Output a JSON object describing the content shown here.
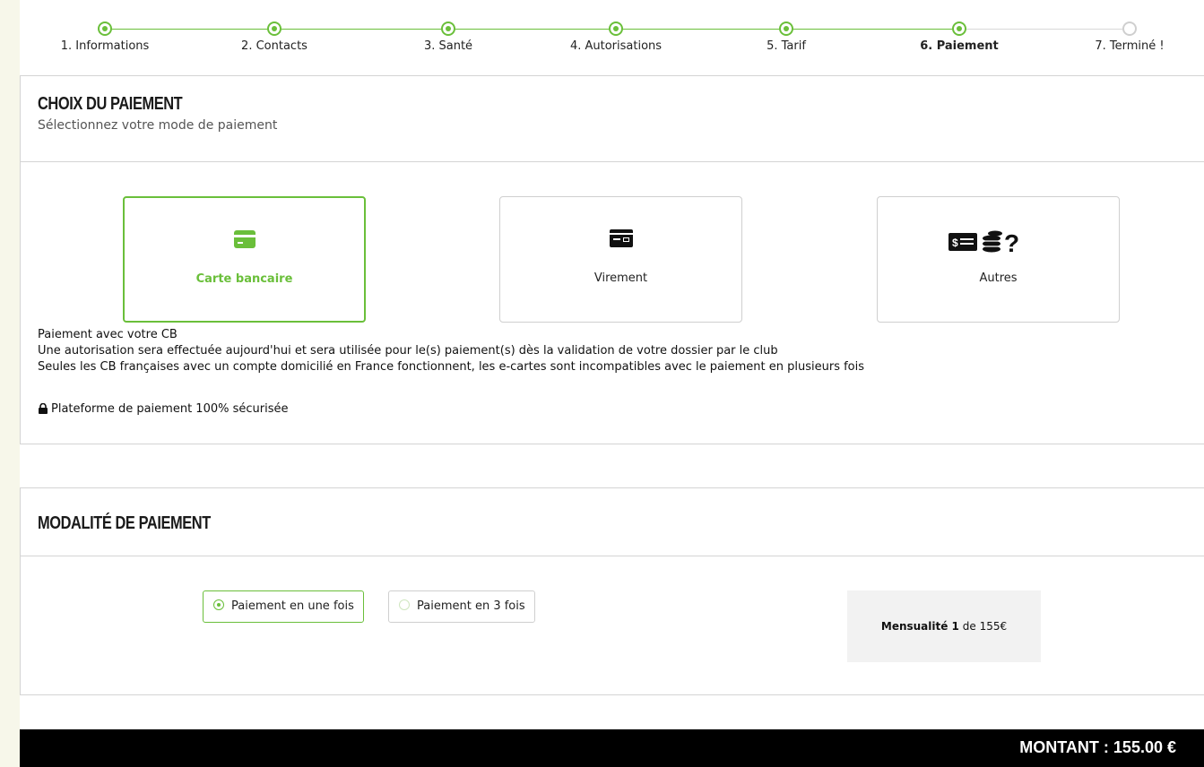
{
  "stepper": {
    "steps": [
      {
        "label": "1. Informations",
        "state": "done"
      },
      {
        "label": "2. Contacts",
        "state": "done"
      },
      {
        "label": "3. Santé",
        "state": "done"
      },
      {
        "label": "4. Autorisations",
        "state": "done"
      },
      {
        "label": "5. Tarif",
        "state": "done"
      },
      {
        "label": "6. Paiement",
        "state": "active"
      },
      {
        "label": "7. Terminé !",
        "state": "todo"
      }
    ]
  },
  "choice": {
    "title": "Choix du paiement",
    "subtitle": "Sélectionnez votre mode de paiement",
    "options": [
      {
        "label": "Carte bancaire",
        "icon": "credit-card-icon",
        "selected": true
      },
      {
        "label": "Virement",
        "icon": "bank-transfer-icon",
        "selected": false
      },
      {
        "label": "Autres",
        "icon": "cash-coins-question-icon",
        "selected": false
      }
    ],
    "info_lines": [
      "Paiement avec votre CB",
      "Une autorisation sera effectuée aujourd'hui et sera utilisée pour le(s) paiement(s) dès la validation de votre dossier par le club",
      "Seules les CB françaises avec un compte domicilié en France fonctionnent, les e-cartes sont incompatibles avec le paiement en plusieurs fois"
    ],
    "secure_text": "Plateforme de paiement 100% sécurisée"
  },
  "modalite": {
    "title": "Modalité de paiement",
    "options": [
      {
        "label": "Paiement en une fois",
        "selected": true
      },
      {
        "label": "Paiement en 3 fois",
        "selected": false
      }
    ],
    "mensualite_label": "Mensualité 1",
    "mensualite_value": "de 155€"
  },
  "footer": {
    "montant": "MONTANT : 155.00 €"
  },
  "colors": {
    "accent": "#6abf3a",
    "footer_bg": "#000000"
  }
}
